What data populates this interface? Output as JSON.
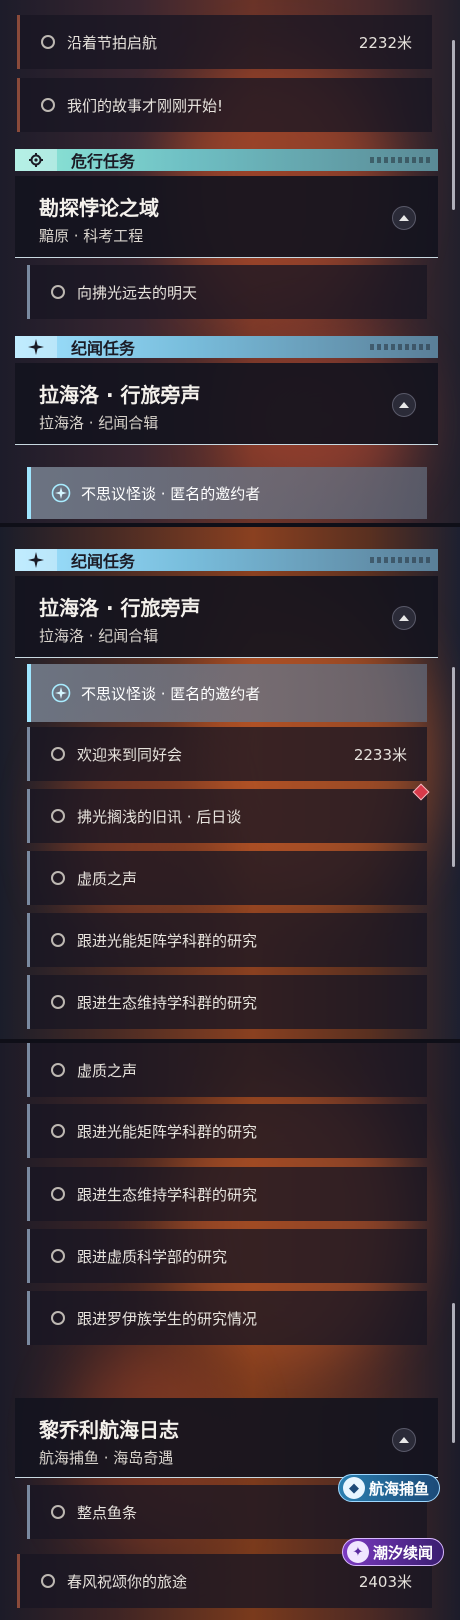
{
  "panel1": {
    "rows_top": [
      {
        "label": "沿着节拍启航",
        "distance": "2232米"
      },
      {
        "label": "我们的故事才刚刚开始!",
        "distance": ""
      }
    ],
    "danger_category": "危行任务",
    "danger_quest": {
      "title": "勘探悖论之域",
      "subtitle": "黯原 · 科考工程"
    },
    "danger_row": "向拂光远去的明天",
    "lore_category": "纪闻任务",
    "lore_quest": {
      "title": "拉海洛 · 行旅旁声",
      "subtitle": "拉海洛 · 纪闻合辑"
    },
    "active_row": "不思议怪谈 · 匿名的邀约者"
  },
  "panel2": {
    "lore_category": "纪闻任务",
    "lore_quest": {
      "title": "拉海洛 · 行旅旁声",
      "subtitle": "拉海洛 · 纪闻合辑"
    },
    "active_row": "不思议怪谈 · 匿名的邀约者",
    "rows": [
      {
        "label": "欢迎来到同好会",
        "distance": "2233米"
      },
      {
        "label": "拂光搁浅的旧讯 · 后日谈",
        "distance": ""
      },
      {
        "label": "虚质之声",
        "distance": ""
      },
      {
        "label": "跟进光能矩阵学科群的研究",
        "distance": ""
      },
      {
        "label": "跟进生态维持学科群的研究",
        "distance": ""
      }
    ]
  },
  "panel3": {
    "rows": [
      {
        "label": "虚质之声"
      },
      {
        "label": "跟进光能矩阵学科群的研究"
      },
      {
        "label": "跟进生态维持学科群的研究"
      },
      {
        "label": "跟进虚质科学部的研究"
      },
      {
        "label": "跟进罗伊族学生的研究情况"
      }
    ],
    "quest": {
      "title": "黎乔利航海日志",
      "subtitle": "航海捕鱼 · 海岛奇遇"
    },
    "row_after": "整点鱼条",
    "row_last": {
      "label": "春风祝颂你的旅途",
      "distance": "2403米"
    },
    "tag_fishing": "航海捕鱼",
    "tag_tide": "潮汐续闻"
  },
  "colors": {
    "accent_teal": "#8ee8d8",
    "accent_blue": "#9fe6ff",
    "marker_red": "#d83a4a"
  }
}
